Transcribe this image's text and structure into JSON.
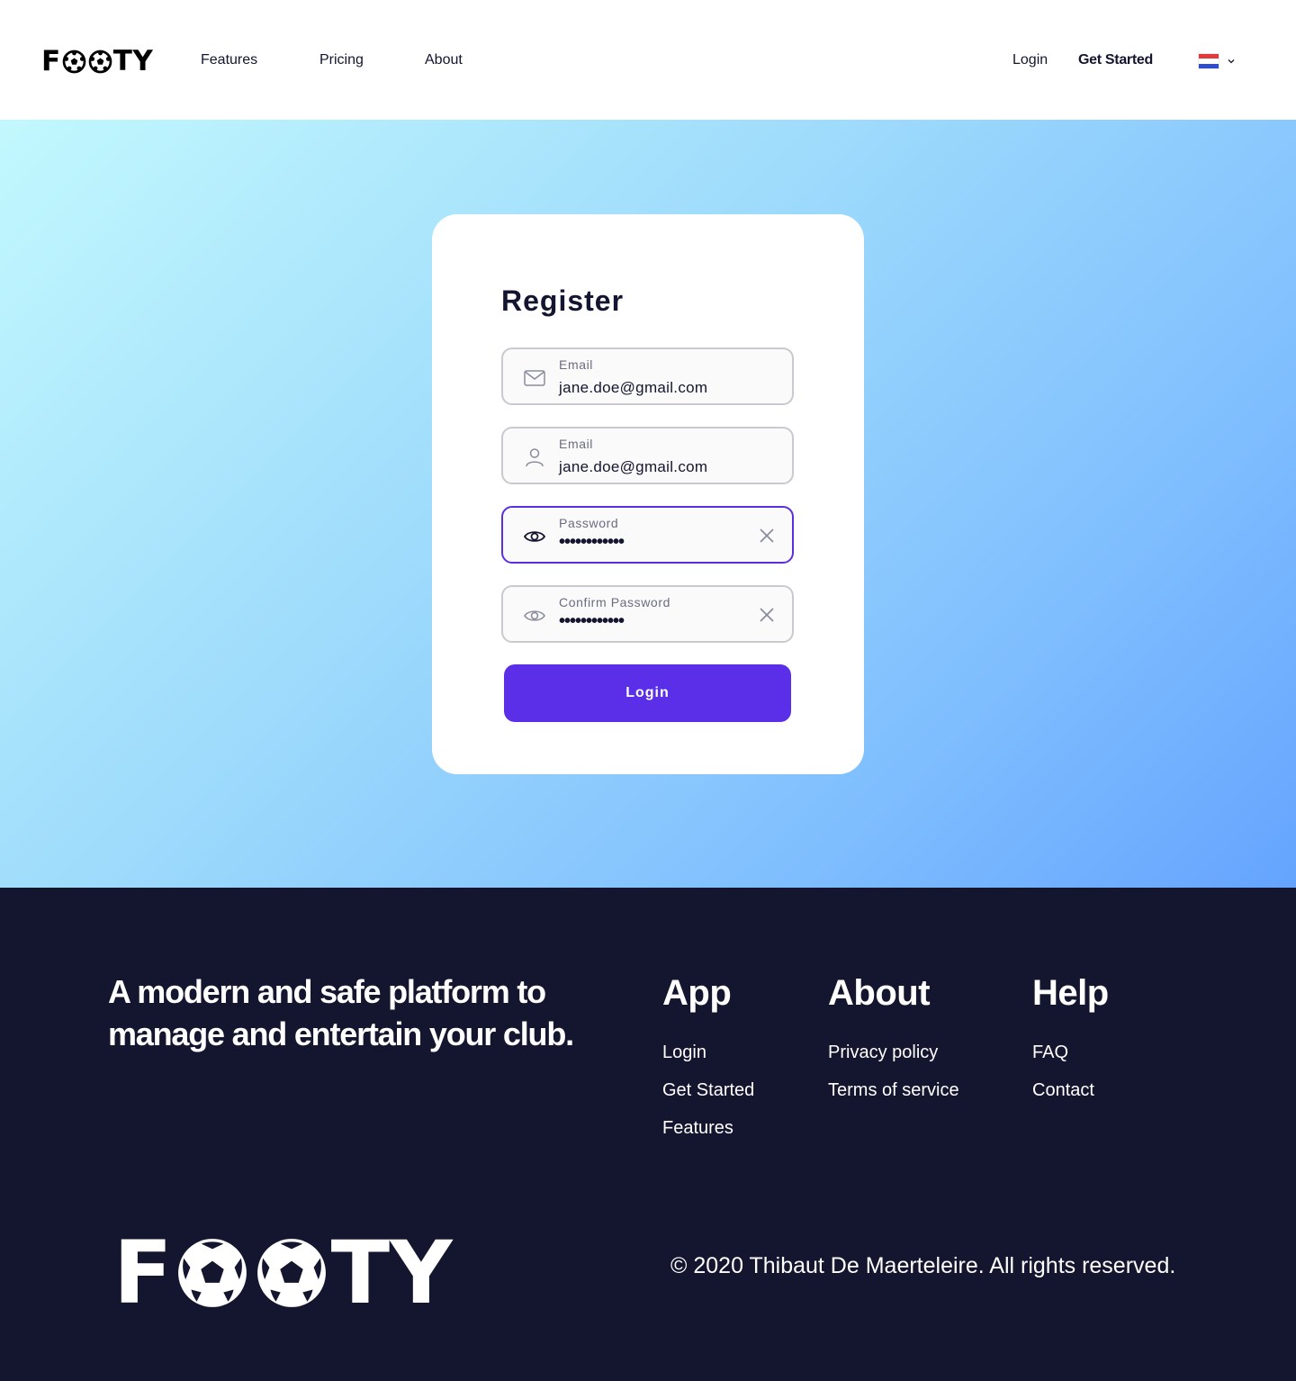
{
  "header": {
    "logo_prefix": "F",
    "logo_suffix": "TY",
    "nav": [
      "Features",
      "Pricing",
      "About"
    ],
    "login_label": "Login",
    "get_started_label": "Get Started",
    "language_flag": "netherlands-flag"
  },
  "register": {
    "title": "Register",
    "fields": [
      {
        "icon": "mail-icon",
        "label": "Email",
        "value": "jane.doe@gmail.com"
      },
      {
        "icon": "user-icon",
        "label": "Email",
        "value": "jane.doe@gmail.com"
      },
      {
        "icon": "eye-icon",
        "label": "Password",
        "value": "••••••••••••",
        "active": true
      },
      {
        "icon": "eye-icon",
        "label": "Confirm Password",
        "value": "••••••••••••"
      }
    ],
    "submit_label": "Login"
  },
  "footer": {
    "tagline": "A modern and safe platform to manage and entertain your club.",
    "columns": [
      {
        "title": "App",
        "links": [
          "Login",
          "Get Started",
          "Features"
        ]
      },
      {
        "title": "About",
        "links": [
          "Privacy policy",
          "Terms of service"
        ]
      },
      {
        "title": "Help",
        "links": [
          "FAQ",
          "Contact"
        ]
      }
    ],
    "logo_prefix": "F",
    "logo_suffix": "TY",
    "copyright": "© 2020 Thibaut De Maerteleire. All rights reserved."
  },
  "colors": {
    "accent": "#5b2fe8",
    "footer_bg": "#14152e",
    "hero_gradient_start": "#c2f8fd",
    "hero_gradient_end": "#65a4fe"
  }
}
